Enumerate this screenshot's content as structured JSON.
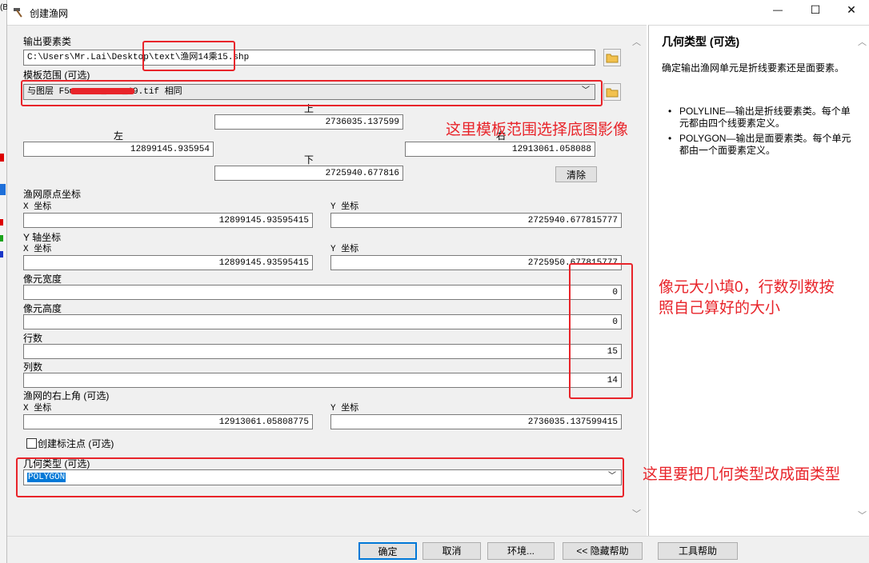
{
  "window": {
    "title": "创建渔网"
  },
  "titlebar_controls": {
    "minimize": "—",
    "maximize": "☐",
    "close": "✕"
  },
  "left_edge": {
    "text": "(B"
  },
  "form": {
    "output_label": "输出要素类",
    "output_value": "C:\\Users\\Mr.Lai\\Desktop\\text\\渔网14乘15.shp",
    "template_label": "模板范围 (可选)",
    "template_value": "与图层 F5■■■■■■_■■■_19.tif 相同",
    "extent": {
      "top_label": "上",
      "top_value": "2736035.137599",
      "left_label": "左",
      "left_value": "12899145.935954",
      "right_label": "右",
      "right_value": "12913061.058088",
      "bottom_label": "下",
      "bottom_value": "2725940.677816",
      "clear_button": "清除"
    },
    "origin_label": "渔网原点坐标",
    "origin_x_label": "X 坐标",
    "origin_x_value": "12899145.93595415",
    "origin_y_label": "Y 坐标",
    "origin_y_value": "2725940.677815777",
    "yaxis_label": "Y 轴坐标",
    "yaxis_x_label": "X 坐标",
    "yaxis_x_value": "12899145.93595415",
    "yaxis_y_label": "Y 坐标",
    "yaxis_y_value": "2725950.677815777",
    "cell_width_label": "像元宽度",
    "cell_width_value": "0",
    "cell_height_label": "像元高度",
    "cell_height_value": "0",
    "rows_label": "行数",
    "rows_value": "15",
    "cols_label": "列数",
    "cols_value": "14",
    "corner_label": "渔网的右上角 (可选)",
    "corner_x_label": "X 坐标",
    "corner_x_value": "12913061.05808775",
    "corner_y_label": "Y 坐标",
    "corner_y_value": "2736035.137599415",
    "label_points_label": "创建标注点 (可选)",
    "label_points_checked": false,
    "geometry_label": "几何类型 (可选)",
    "geometry_value": "POLYGON"
  },
  "help": {
    "title": "几何类型 (可选)",
    "intro": "确定输出渔网单元是折线要素还是面要素。",
    "bullets": [
      "POLYLINE—输出是折线要素类。每个单元都由四个线要素定义。",
      "POLYGON—输出是面要素类。每个单元都由一个面要素定义。"
    ]
  },
  "annotations": {
    "template_note": "这里模板范围选择底图影像",
    "cell_note_line1": "像元大小填0，行数列数按",
    "cell_note_line2": "照自己算好的大小",
    "geometry_note": "这里要把几何类型改成面类型"
  },
  "buttons": {
    "ok": "确定",
    "cancel": "取消",
    "environments": "环境...",
    "hide_help": "<< 隐藏帮助",
    "tool_help": "工具帮助"
  },
  "colors": {
    "annotation_red": "#e8242a",
    "selection_blue": "#0078d7"
  }
}
